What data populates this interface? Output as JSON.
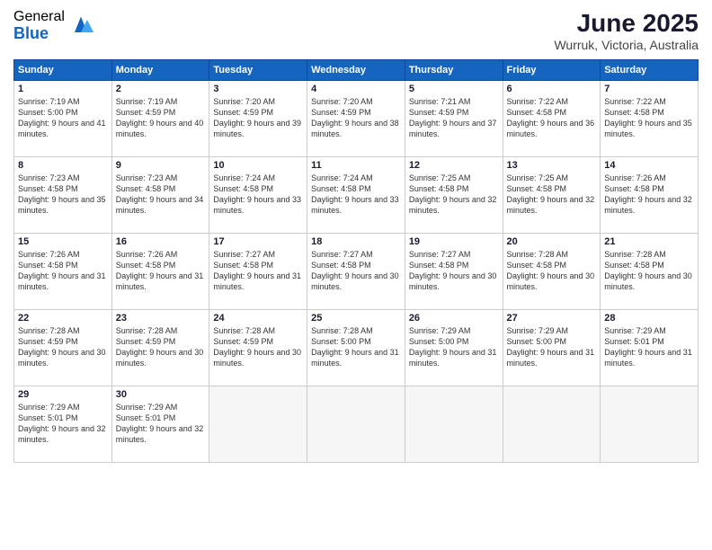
{
  "logo": {
    "general": "General",
    "blue": "Blue"
  },
  "title": "June 2025",
  "subtitle": "Wurruk, Victoria, Australia",
  "weekdays": [
    "Sunday",
    "Monday",
    "Tuesday",
    "Wednesday",
    "Thursday",
    "Friday",
    "Saturday"
  ],
  "weeks": [
    [
      {
        "day": "1",
        "sunrise": "7:19 AM",
        "sunset": "5:00 PM",
        "daylight": "9 hours and 41 minutes."
      },
      {
        "day": "2",
        "sunrise": "7:19 AM",
        "sunset": "4:59 PM",
        "daylight": "9 hours and 40 minutes."
      },
      {
        "day": "3",
        "sunrise": "7:20 AM",
        "sunset": "4:59 PM",
        "daylight": "9 hours and 39 minutes."
      },
      {
        "day": "4",
        "sunrise": "7:20 AM",
        "sunset": "4:59 PM",
        "daylight": "9 hours and 38 minutes."
      },
      {
        "day": "5",
        "sunrise": "7:21 AM",
        "sunset": "4:59 PM",
        "daylight": "9 hours and 37 minutes."
      },
      {
        "day": "6",
        "sunrise": "7:22 AM",
        "sunset": "4:58 PM",
        "daylight": "9 hours and 36 minutes."
      },
      {
        "day": "7",
        "sunrise": "7:22 AM",
        "sunset": "4:58 PM",
        "daylight": "9 hours and 35 minutes."
      }
    ],
    [
      {
        "day": "8",
        "sunrise": "7:23 AM",
        "sunset": "4:58 PM",
        "daylight": "9 hours and 35 minutes."
      },
      {
        "day": "9",
        "sunrise": "7:23 AM",
        "sunset": "4:58 PM",
        "daylight": "9 hours and 34 minutes."
      },
      {
        "day": "10",
        "sunrise": "7:24 AM",
        "sunset": "4:58 PM",
        "daylight": "9 hours and 33 minutes."
      },
      {
        "day": "11",
        "sunrise": "7:24 AM",
        "sunset": "4:58 PM",
        "daylight": "9 hours and 33 minutes."
      },
      {
        "day": "12",
        "sunrise": "7:25 AM",
        "sunset": "4:58 PM",
        "daylight": "9 hours and 32 minutes."
      },
      {
        "day": "13",
        "sunrise": "7:25 AM",
        "sunset": "4:58 PM",
        "daylight": "9 hours and 32 minutes."
      },
      {
        "day": "14",
        "sunrise": "7:26 AM",
        "sunset": "4:58 PM",
        "daylight": "9 hours and 32 minutes."
      }
    ],
    [
      {
        "day": "15",
        "sunrise": "7:26 AM",
        "sunset": "4:58 PM",
        "daylight": "9 hours and 31 minutes."
      },
      {
        "day": "16",
        "sunrise": "7:26 AM",
        "sunset": "4:58 PM",
        "daylight": "9 hours and 31 minutes."
      },
      {
        "day": "17",
        "sunrise": "7:27 AM",
        "sunset": "4:58 PM",
        "daylight": "9 hours and 31 minutes."
      },
      {
        "day": "18",
        "sunrise": "7:27 AM",
        "sunset": "4:58 PM",
        "daylight": "9 hours and 30 minutes."
      },
      {
        "day": "19",
        "sunrise": "7:27 AM",
        "sunset": "4:58 PM",
        "daylight": "9 hours and 30 minutes."
      },
      {
        "day": "20",
        "sunrise": "7:28 AM",
        "sunset": "4:58 PM",
        "daylight": "9 hours and 30 minutes."
      },
      {
        "day": "21",
        "sunrise": "7:28 AM",
        "sunset": "4:58 PM",
        "daylight": "9 hours and 30 minutes."
      }
    ],
    [
      {
        "day": "22",
        "sunrise": "7:28 AM",
        "sunset": "4:59 PM",
        "daylight": "9 hours and 30 minutes."
      },
      {
        "day": "23",
        "sunrise": "7:28 AM",
        "sunset": "4:59 PM",
        "daylight": "9 hours and 30 minutes."
      },
      {
        "day": "24",
        "sunrise": "7:28 AM",
        "sunset": "4:59 PM",
        "daylight": "9 hours and 30 minutes."
      },
      {
        "day": "25",
        "sunrise": "7:28 AM",
        "sunset": "5:00 PM",
        "daylight": "9 hours and 31 minutes."
      },
      {
        "day": "26",
        "sunrise": "7:29 AM",
        "sunset": "5:00 PM",
        "daylight": "9 hours and 31 minutes."
      },
      {
        "day": "27",
        "sunrise": "7:29 AM",
        "sunset": "5:00 PM",
        "daylight": "9 hours and 31 minutes."
      },
      {
        "day": "28",
        "sunrise": "7:29 AM",
        "sunset": "5:01 PM",
        "daylight": "9 hours and 31 minutes."
      }
    ],
    [
      {
        "day": "29",
        "sunrise": "7:29 AM",
        "sunset": "5:01 PM",
        "daylight": "9 hours and 32 minutes."
      },
      {
        "day": "30",
        "sunrise": "7:29 AM",
        "sunset": "5:01 PM",
        "daylight": "9 hours and 32 minutes."
      },
      null,
      null,
      null,
      null,
      null
    ]
  ],
  "labels": {
    "sunrise": "Sunrise:",
    "sunset": "Sunset:",
    "daylight": "Daylight:"
  }
}
